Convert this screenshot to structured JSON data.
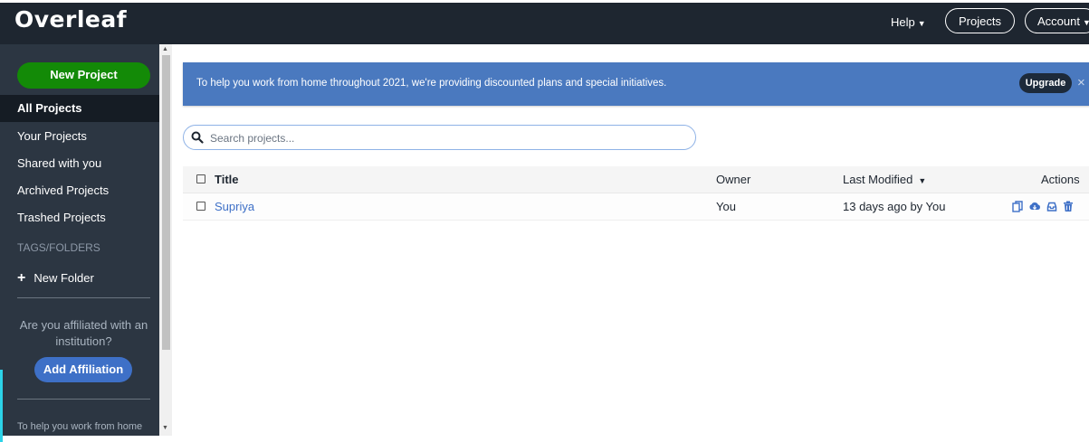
{
  "navbar": {
    "logo": "Overleaf",
    "help": "Help",
    "projects": "Projects",
    "account": "Account"
  },
  "sidebar": {
    "new_project": "New Project",
    "items": [
      {
        "label": "All Projects",
        "active": true
      },
      {
        "label": "Your Projects",
        "active": false
      },
      {
        "label": "Shared with you",
        "active": false
      },
      {
        "label": "Archived Projects",
        "active": false
      },
      {
        "label": "Trashed Projects",
        "active": false
      }
    ],
    "tags_title": "TAGS/FOLDERS",
    "new_folder": "New Folder",
    "affiliation_prompt": "Are you affiliated with an institution?",
    "add_affiliation": "Add Affiliation",
    "bottom_text": "To help you work from home"
  },
  "banner": {
    "text": "To help you work from home throughout 2021, we're providing discounted plans and special initiatives.",
    "upgrade": "Upgrade",
    "close": "×"
  },
  "search": {
    "placeholder": "Search projects..."
  },
  "table": {
    "headers": {
      "title": "Title",
      "owner": "Owner",
      "last_modified": "Last Modified",
      "actions": "Actions"
    },
    "rows": [
      {
        "title": "Supriya",
        "owner": "You",
        "last_modified": "13 days ago by You"
      }
    ]
  },
  "icons": [
    "search-icon",
    "copy-icon",
    "download-icon",
    "archive-icon",
    "trash-icon",
    "plus-icon"
  ],
  "colors": {
    "navbar": "#1e2630",
    "sidebar": "#2c3642",
    "new_project": "#138a07",
    "banner": "#4a79bf",
    "link": "#3e70c7"
  }
}
